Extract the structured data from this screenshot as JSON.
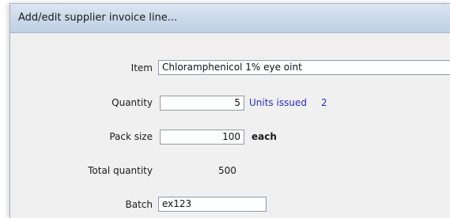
{
  "window": {
    "title": "Add/edit supplier invoice line..."
  },
  "form": {
    "item": {
      "label": "Item",
      "value": "Chloramphenicol 1% eye oint"
    },
    "quantity": {
      "label": "Quantity",
      "value": "5"
    },
    "units_issued": {
      "label": "Units issued",
      "value": "2"
    },
    "pack_size": {
      "label": "Pack size",
      "value": "100",
      "unit": "each"
    },
    "total_quantity": {
      "label": "Total quantity",
      "value": "500"
    },
    "batch": {
      "label": "Batch",
      "value": "ex123"
    }
  },
  "colors": {
    "titlebar": "#cad8ea",
    "window_bg": "#f0f0f0",
    "units_issued_text": "#2a2ad4"
  }
}
